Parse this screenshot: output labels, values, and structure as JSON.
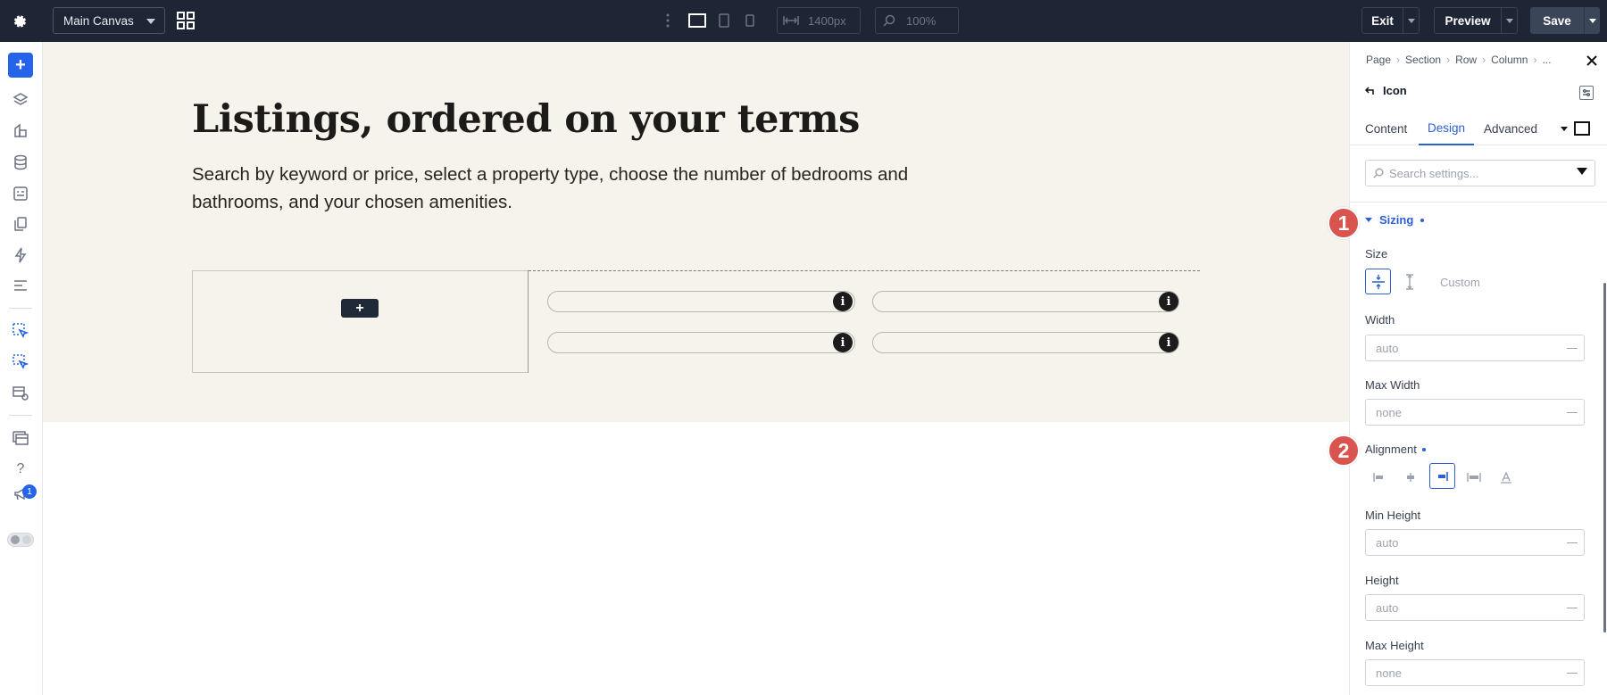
{
  "topbar": {
    "canvas_select": "Main Canvas",
    "width_value": "1400px",
    "zoom_value": "100%",
    "exit_label": "Exit",
    "preview_label": "Preview",
    "save_label": "Save"
  },
  "leftbar": {
    "add_label": "+",
    "notification_count": "1",
    "help_label": "?"
  },
  "canvas": {
    "heading": "Listings, ordered on your terms",
    "subtext": "Search by keyword or price, select a property type, choose the number of bedrooms and bathrooms, and your chosen amenities.",
    "add_module_label": "+",
    "info_glyph": "i"
  },
  "panel": {
    "breadcrumbs": [
      "Page",
      "Section",
      "Row",
      "Column",
      "..."
    ],
    "element_name": "Icon",
    "tabs": [
      "Content",
      "Design",
      "Advanced"
    ],
    "active_tab": "Design",
    "search_placeholder": "Search settings...",
    "section_title": "Sizing",
    "size_label": "Size",
    "custom_label": "Custom",
    "width_label": "Width",
    "width_value": "auto",
    "max_width_label": "Max Width",
    "max_width_value": "none",
    "alignment_label": "Alignment",
    "alignment_selected": "right",
    "min_height_label": "Min Height",
    "min_height_value": "auto",
    "height_label": "Height",
    "height_value": "auto",
    "max_height_label": "Max Height",
    "max_height_value": "none"
  },
  "markers": [
    "1",
    "2"
  ],
  "colors": {
    "topbar_bg": "#1e2535",
    "accent": "#2d5fd4",
    "add_button": "#2563eb",
    "hero_bg": "#f6f3ec",
    "marker": "#d9534f"
  }
}
